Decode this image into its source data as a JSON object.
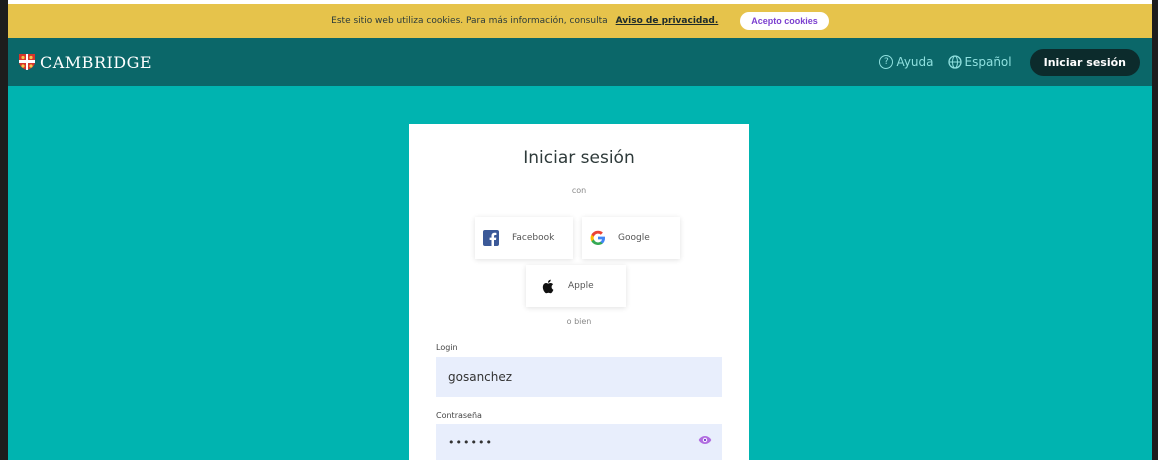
{
  "cookie_bar": {
    "text": "Este sitio web utiliza cookies. Para más información, consulta",
    "link": "Aviso de privacidad.",
    "button": "Acepto cookies"
  },
  "header": {
    "logo_text": "CAMBRIDGE",
    "help": "Ayuda",
    "language": "Español",
    "signin_button": "Iniciar sesión"
  },
  "card": {
    "title": "Iniciar sesión",
    "with": "con",
    "social": {
      "facebook": "Facebook",
      "google": "Google",
      "apple": "Apple"
    },
    "or": "o bien",
    "login_label": "Login",
    "login_value": "gosanchez",
    "password_label": "Contraseña",
    "password_value": "••••••"
  },
  "colors": {
    "cookie_bar": "#e6c34b",
    "header": "#0b6769",
    "background": "#00b4b0",
    "field": "#e8eefc",
    "accent": "#7b3fd0"
  },
  "icons": [
    "cambridge-shield-icon",
    "help-icon",
    "globe-icon",
    "facebook-icon",
    "google-icon",
    "apple-icon",
    "eye-icon"
  ]
}
